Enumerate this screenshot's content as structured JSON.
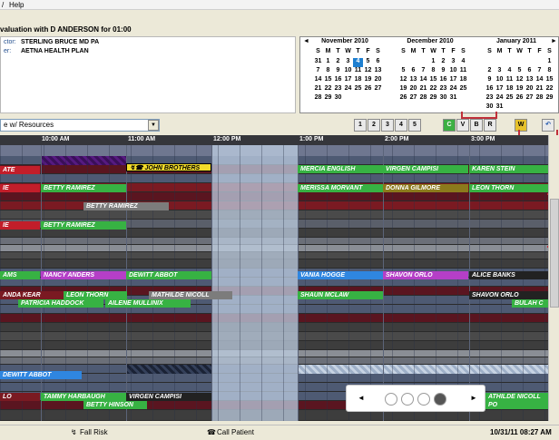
{
  "menu": {
    "items": [
      "Help"
    ]
  },
  "eval": {
    "title": "valuation with D ANDERSON for 01:00"
  },
  "info": {
    "rows": [
      {
        "label": "ctor:",
        "value": "STERLING BRUCE MD PA"
      },
      {
        "label": "er:",
        "value": "AETNA HEALTH PLAN"
      }
    ]
  },
  "calendars": [
    {
      "title": "November 2010",
      "dow": [
        "S",
        "M",
        "T",
        "W",
        "T",
        "F",
        "S"
      ],
      "weeks": [
        [
          "31",
          "1",
          "2",
          "3",
          "4",
          "5",
          "6"
        ],
        [
          "7",
          "8",
          "9",
          "10",
          "11",
          "12",
          "13"
        ],
        [
          "14",
          "15",
          "16",
          "17",
          "18",
          "19",
          "20"
        ],
        [
          "21",
          "22",
          "23",
          "24",
          "25",
          "26",
          "27"
        ],
        [
          "28",
          "29",
          "30",
          "",
          "",
          "",
          ""
        ]
      ]
    },
    {
      "title": "December 2010",
      "dow": [
        "S",
        "M",
        "T",
        "W",
        "T",
        "F",
        "S"
      ],
      "weeks": [
        [
          "",
          "",
          "",
          "1",
          "2",
          "3",
          "4"
        ],
        [
          "5",
          "6",
          "7",
          "8",
          "9",
          "10",
          "11"
        ],
        [
          "12",
          "13",
          "14",
          "15",
          "16",
          "17",
          "18"
        ],
        [
          "19",
          "20",
          "21",
          "22",
          "23",
          "24",
          "25"
        ],
        [
          "26",
          "27",
          "28",
          "29",
          "30",
          "31",
          ""
        ]
      ]
    },
    {
      "title": "January 2011",
      "dow": [
        "S",
        "M",
        "T",
        "W",
        "T",
        "F",
        "S"
      ],
      "weeks": [
        [
          "",
          "",
          "",
          "",
          "",
          "",
          "1"
        ],
        [
          "2",
          "3",
          "4",
          "5",
          "6",
          "7",
          "8"
        ],
        [
          "9",
          "10",
          "11",
          "12",
          "13",
          "14",
          "15"
        ],
        [
          "16",
          "17",
          "18",
          "19",
          "20",
          "21",
          "22"
        ],
        [
          "23",
          "24",
          "25",
          "26",
          "27",
          "28",
          "29"
        ],
        [
          "30",
          "31",
          "",
          "",
          "",
          "",
          ""
        ]
      ]
    }
  ],
  "toolbar": {
    "view": "e w/ Resources",
    "pages": [
      "1",
      "2",
      "3",
      "4",
      "5"
    ],
    "modes": [
      "C",
      "V",
      "B",
      "R"
    ],
    "w": "W"
  },
  "times": [
    "10:00 AM",
    "11:00 AM",
    "12:00 PM",
    "1:00 PM",
    "2:00 PM",
    "3:00 PM"
  ],
  "appointments": [
    {
      "text": "ATE",
      "row": 0
    },
    {
      "text": "JOHN BROTHERS"
    },
    {
      "text": "MERCIA ENGLISH"
    },
    {
      "text": "VIRGEN CAMPISI"
    },
    {
      "text": "KAREN STEIN"
    },
    {
      "text": "IE"
    },
    {
      "text": "BETTY RAMIREZ"
    },
    {
      "text": "MERISSA MORVANT"
    },
    {
      "text": "DONNA GILMORE"
    },
    {
      "text": "LEON THORN"
    },
    {
      "text": "BETTY RAMIREZ"
    },
    {
      "text": "IE"
    },
    {
      "text": "BETTY RAMIREZ"
    },
    {
      "text": "AMS"
    },
    {
      "text": "NANCY ANDERS"
    },
    {
      "text": "DEWITT ABBOT"
    },
    {
      "text": "VANIA HOGGE"
    },
    {
      "text": "SHAVON ORLO"
    },
    {
      "text": "ALICE BANKS"
    },
    {
      "text": "ANDA KEAR"
    },
    {
      "text": "LEON THORN"
    },
    {
      "text": "MATHILDE NICOLL"
    },
    {
      "text": "SHAUN MCLAW"
    },
    {
      "text": "SHAVON ORLO"
    },
    {
      "text": "PATRICIA HADDOCK"
    },
    {
      "text": "AILENE MULLINIX"
    },
    {
      "text": "BULAH C"
    },
    {
      "text": "DEWITT ABBOT"
    },
    {
      "text": "LO"
    },
    {
      "text": "TAMMY HARBAUGH"
    },
    {
      "text": "VIRGEN CAMPISI"
    },
    {
      "text": "BETTY HINSON"
    },
    {
      "text": "ATHILDE NICOLL"
    },
    {
      "text": "PO"
    }
  ],
  "status": {
    "fall_risk": "Fall Risk",
    "call_patient": "Call Patient",
    "datetime": "10/31/11 08:27 AM"
  },
  "carousel": {
    "pages": 4,
    "active": 4
  }
}
